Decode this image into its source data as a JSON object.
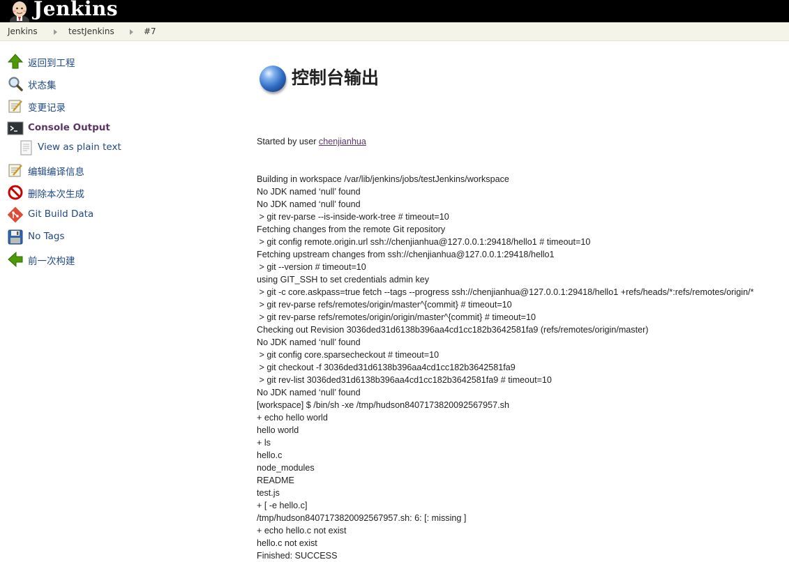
{
  "header": {
    "logo_text": "Jenkins"
  },
  "breadcrumb": [
    "Jenkins",
    "testJenkins",
    "#7"
  ],
  "sidebar": {
    "items": [
      {
        "label": "返回到工程",
        "icon": "up-arrow-icon"
      },
      {
        "label": "状态集",
        "icon": "search-icon"
      },
      {
        "label": "变更记录",
        "icon": "notepad-icon"
      },
      {
        "label": "Console Output",
        "icon": "terminal-icon",
        "active": true
      },
      {
        "label": "View as plain text",
        "icon": "document-icon",
        "sub": true
      },
      {
        "label": "编辑编译信息",
        "icon": "notepad-icon"
      },
      {
        "label": "删除本次生成",
        "icon": "no-entry-icon"
      },
      {
        "label": "Git Build Data",
        "icon": "git-icon"
      },
      {
        "label": "No Tags",
        "icon": "floppy-disk-icon"
      },
      {
        "label": "前一次构建",
        "icon": "left-arrow-icon"
      }
    ]
  },
  "main": {
    "title": "控制台输出",
    "console": {
      "started_prefix": "Started by user ",
      "started_user": "chenjianhua",
      "lines": [
        "Building in workspace /var/lib/jenkins/jobs/testJenkins/workspace",
        "No JDK named ‘null’ found",
        "No JDK named ‘null’ found",
        " > git rev-parse --is-inside-work-tree # timeout=10",
        "Fetching changes from the remote Git repository",
        " > git config remote.origin.url ssh://chenjianhua@127.0.0.1:29418/hello1 # timeout=10",
        "Fetching upstream changes from ssh://chenjianhua@127.0.0.1:29418/hello1",
        " > git --version # timeout=10",
        "using GIT_SSH to set credentials admin key",
        " > git -c core.askpass=true fetch --tags --progress ssh://chenjianhua@127.0.0.1:29418/hello1 +refs/heads/*:refs/remotes/origin/*",
        " > git rev-parse refs/remotes/origin/master^{commit} # timeout=10",
        " > git rev-parse refs/remotes/origin/origin/master^{commit} # timeout=10",
        "Checking out Revision 3036ded31d6138b396aa4cd1cc182b3642581fa9 (refs/remotes/origin/master)",
        "No JDK named ‘null’ found",
        " > git config core.sparsecheckout # timeout=10",
        " > git checkout -f 3036ded31d6138b396aa4cd1cc182b3642581fa9",
        " > git rev-list 3036ded31d6138b396aa4cd1cc182b3642581fa9 # timeout=10",
        "No JDK named ‘null’ found",
        "[workspace] $ /bin/sh -xe /tmp/hudson8407173820092567957.sh",
        "+ echo hello world",
        "hello world",
        "+ ls",
        "hello.c",
        "node_modules",
        "README",
        "test.js",
        "+ [ -e hello.c]",
        "/tmp/hudson8407173820092567957.sh: 6: [: missing ]",
        "+ echo hello.c not exist",
        "hello.c not exist",
        "Finished: SUCCESS"
      ]
    }
  }
}
